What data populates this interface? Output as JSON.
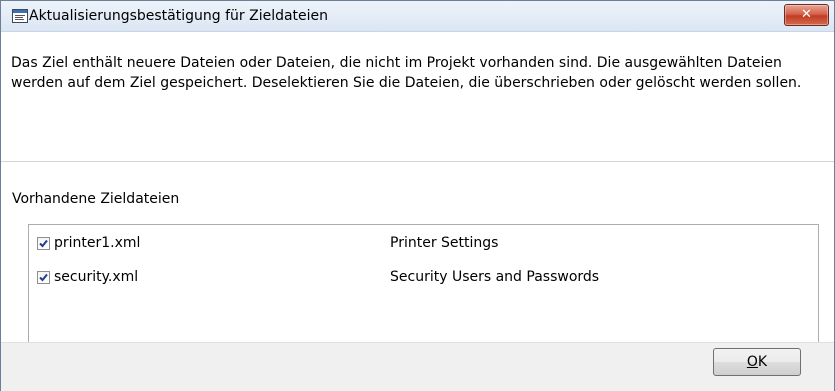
{
  "window": {
    "title": "Aktualisierungsbestätigung für Zieldateien",
    "close_glyph": "✕"
  },
  "description": "Das Ziel enthält neuere Dateien oder Dateien, die nicht im Projekt vorhanden sind.  Die ausgewählten Dateien werden auf dem Ziel gespeichert. Deselektieren Sie die Dateien, die überschrieben oder gelöscht werden sollen.",
  "group_label": "Vorhandene Zieldateien",
  "files": [
    {
      "name": "printer1.xml",
      "description": "Printer Settings",
      "checked": true
    },
    {
      "name": "security.xml",
      "description": "Security Users and Passwords",
      "checked": true
    }
  ],
  "buttons": {
    "ok_mnemonic": "O",
    "ok_rest": "K"
  },
  "icons": {
    "app": "dialog-window-icon",
    "close": "close-icon",
    "check": "checkmark-icon"
  },
  "colors": {
    "close_button": "#c7432a",
    "titlebar": "#dbe6f4",
    "content_bg": "#ffffff",
    "footer_bg": "#f0f0f0"
  }
}
